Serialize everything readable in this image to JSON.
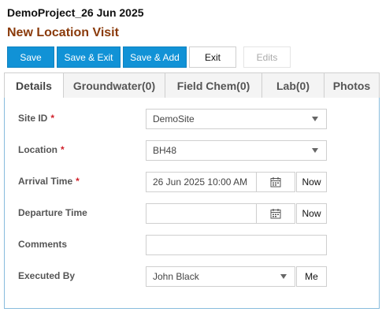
{
  "header": {
    "project": "DemoProject_26 Jun 2025",
    "title": "New Location Visit"
  },
  "toolbar": {
    "save": "Save",
    "save_exit": "Save & Exit",
    "save_add": "Save & Add",
    "exit": "Exit",
    "edits": "Edits"
  },
  "tabs": [
    {
      "label": "Details"
    },
    {
      "label": "Groundwater(0)"
    },
    {
      "label": "Field Chem(0)"
    },
    {
      "label": "Lab(0)"
    },
    {
      "label": "Photos"
    }
  ],
  "form": {
    "site_id": {
      "label": "Site ID",
      "value": "DemoSite"
    },
    "location": {
      "label": "Location",
      "value": "BH48"
    },
    "arrival": {
      "label": "Arrival Time",
      "value": "26 Jun 2025 10:00 AM",
      "button": "Now"
    },
    "departure": {
      "label": "Departure Time",
      "value": "",
      "button": "Now"
    },
    "comments": {
      "label": "Comments",
      "value": ""
    },
    "executed_by": {
      "label": "Executed By",
      "value": "John Black",
      "button": "Me"
    },
    "required_mark": "*"
  },
  "colors": {
    "primary_button": "#1192d6",
    "title": "#8a3a0a",
    "required": "#d0212b",
    "panel_border": "#88bcdd"
  },
  "icons": [
    "calendar-icon",
    "chevron-down-icon"
  ]
}
